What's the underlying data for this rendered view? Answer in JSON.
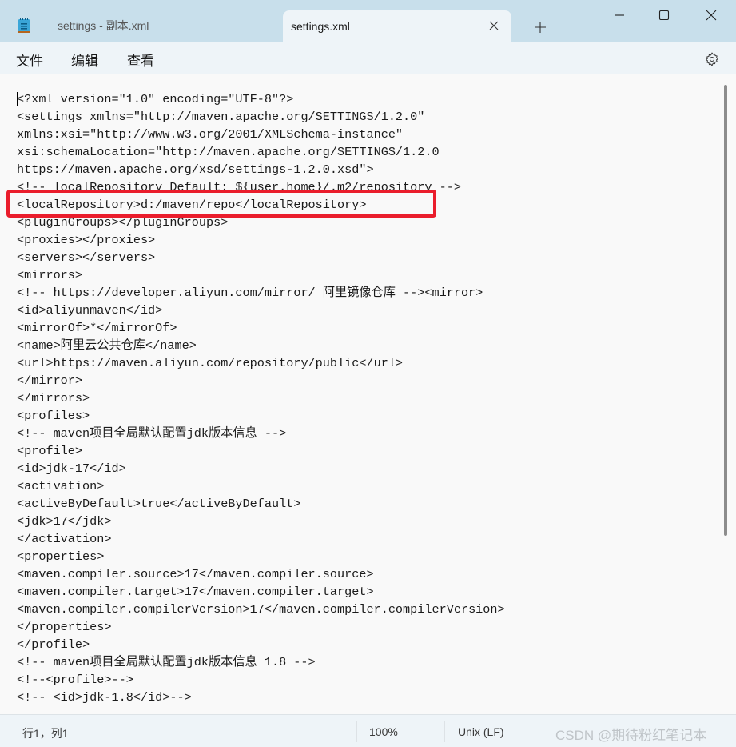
{
  "titlebar": {
    "tabs": [
      {
        "label": "settings - 副本.xml",
        "active": false
      },
      {
        "label": "settings.xml",
        "active": true
      }
    ],
    "icons": {
      "app": "notepad-icon",
      "close_tab": "close-icon",
      "new_tab": "plus-icon",
      "minimize": "minimize-icon",
      "maximize": "maximize-icon",
      "close_window": "close-icon"
    }
  },
  "menubar": {
    "items": [
      "文件",
      "编辑",
      "查看"
    ],
    "settings_icon": "gear-icon"
  },
  "editor": {
    "lines": [
      "<?xml version=\"1.0\" encoding=\"UTF-8\"?>",
      "<settings xmlns=\"http://maven.apache.org/SETTINGS/1.2.0\"",
      "xmlns:xsi=\"http://www.w3.org/2001/XMLSchema-instance\"",
      "xsi:schemaLocation=\"http://maven.apache.org/SETTINGS/1.2.0",
      "https://maven.apache.org/xsd/settings-1.2.0.xsd\">",
      "<!-- localRepository Default: ${user.home}/.m2/repository -->",
      "<localRepository>d:/maven/repo</localRepository>",
      "<pluginGroups></pluginGroups>",
      "<proxies></proxies>",
      "<servers></servers>",
      "<mirrors>",
      "<!-- https://developer.aliyun.com/mirror/ 阿里镜像仓库 --><mirror>",
      "<id>aliyunmaven</id>",
      "<mirrorOf>*</mirrorOf>",
      "<name>阿里云公共仓库</name>",
      "<url>https://maven.aliyun.com/repository/public</url>",
      "</mirror>",
      "</mirrors>",
      "<profiles>",
      "<!-- maven项目全局默认配置jdk版本信息 -->",
      "<profile>",
      "<id>jdk-17</id>",
      "<activation>",
      "<activeByDefault>true</activeByDefault>",
      "<jdk>17</jdk>",
      "</activation>",
      "<properties>",
      "<maven.compiler.source>17</maven.compiler.source>",
      "<maven.compiler.target>17</maven.compiler.target>",
      "<maven.compiler.compilerVersion>17</maven.compiler.compilerVersion>",
      "</properties>",
      "</profile>",
      "<!-- maven项目全局默认配置jdk版本信息 1.8 -->",
      "<!--<profile>-->",
      "<!-- <id>jdk-1.8</id>-->"
    ],
    "highlighted_line_index": 6,
    "highlight_color": "#ea1d2c"
  },
  "statusbar": {
    "position": "行1，列1",
    "zoom": "100%",
    "line_ending": "Unix (LF)",
    "watermark": "CSDN @期待粉红笔记本"
  }
}
